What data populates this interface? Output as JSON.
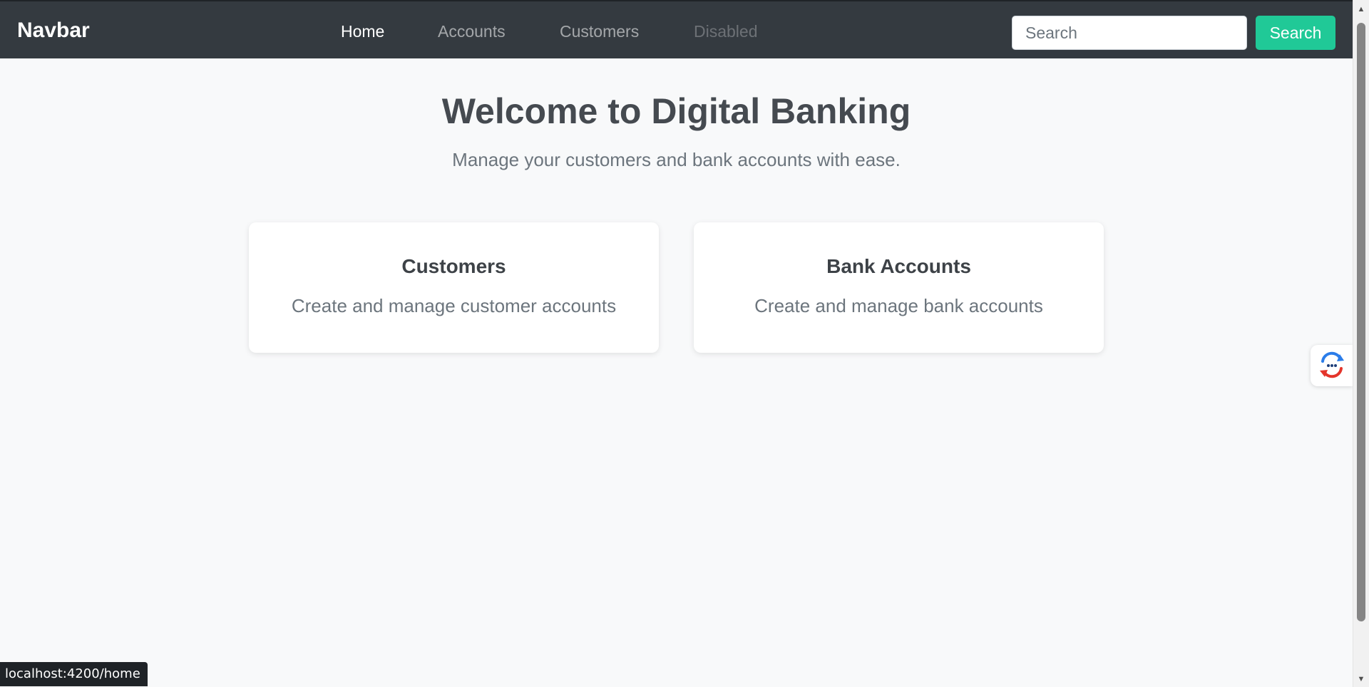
{
  "navbar": {
    "brand": "Navbar",
    "links": [
      {
        "label": "Home",
        "state": "active"
      },
      {
        "label": "Accounts",
        "state": "normal"
      },
      {
        "label": "Customers",
        "state": "normal"
      },
      {
        "label": "Disabled",
        "state": "disabled"
      }
    ],
    "search": {
      "placeholder": "Search",
      "value": "",
      "button_label": "Search"
    }
  },
  "hero": {
    "title": "Welcome to Digital Banking",
    "subtitle": "Manage your customers and bank accounts with ease."
  },
  "cards": [
    {
      "title": "Customers",
      "text": "Create and manage customer accounts"
    },
    {
      "title": "Bank Accounts",
      "text": "Create and manage bank accounts"
    }
  ],
  "widget": {
    "icon": "chat-refresh-icon"
  },
  "status_bar": {
    "url": "localhost:4200/home"
  },
  "colors": {
    "navbar_bg": "#343a40",
    "page_bg": "#f8f9fa",
    "search_button": "#20c997",
    "heading": "#454a50",
    "muted_text": "#6c757d"
  }
}
